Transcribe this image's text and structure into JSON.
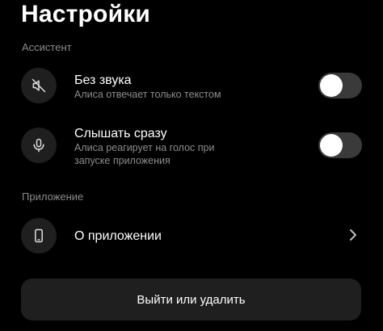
{
  "page": {
    "title": "Настройки"
  },
  "assistant_section": {
    "label": "Ассистент",
    "items": [
      {
        "title": "Без звука",
        "subtitle": "Алиса отвечает только текстом",
        "icon": "mute-speaker-icon",
        "toggle_on": false
      },
      {
        "title": "Слышать сразу",
        "subtitle": "Алиса реагирует на голос при запуске приложения",
        "icon": "microphone-icon",
        "toggle_on": false
      }
    ]
  },
  "app_section": {
    "label": "Приложение",
    "items": [
      {
        "title": "О приложении",
        "icon": "phone-icon",
        "trailing_icon": "chevron-right-icon"
      }
    ]
  },
  "footer": {
    "exit_label": "Выйти или удалить"
  }
}
